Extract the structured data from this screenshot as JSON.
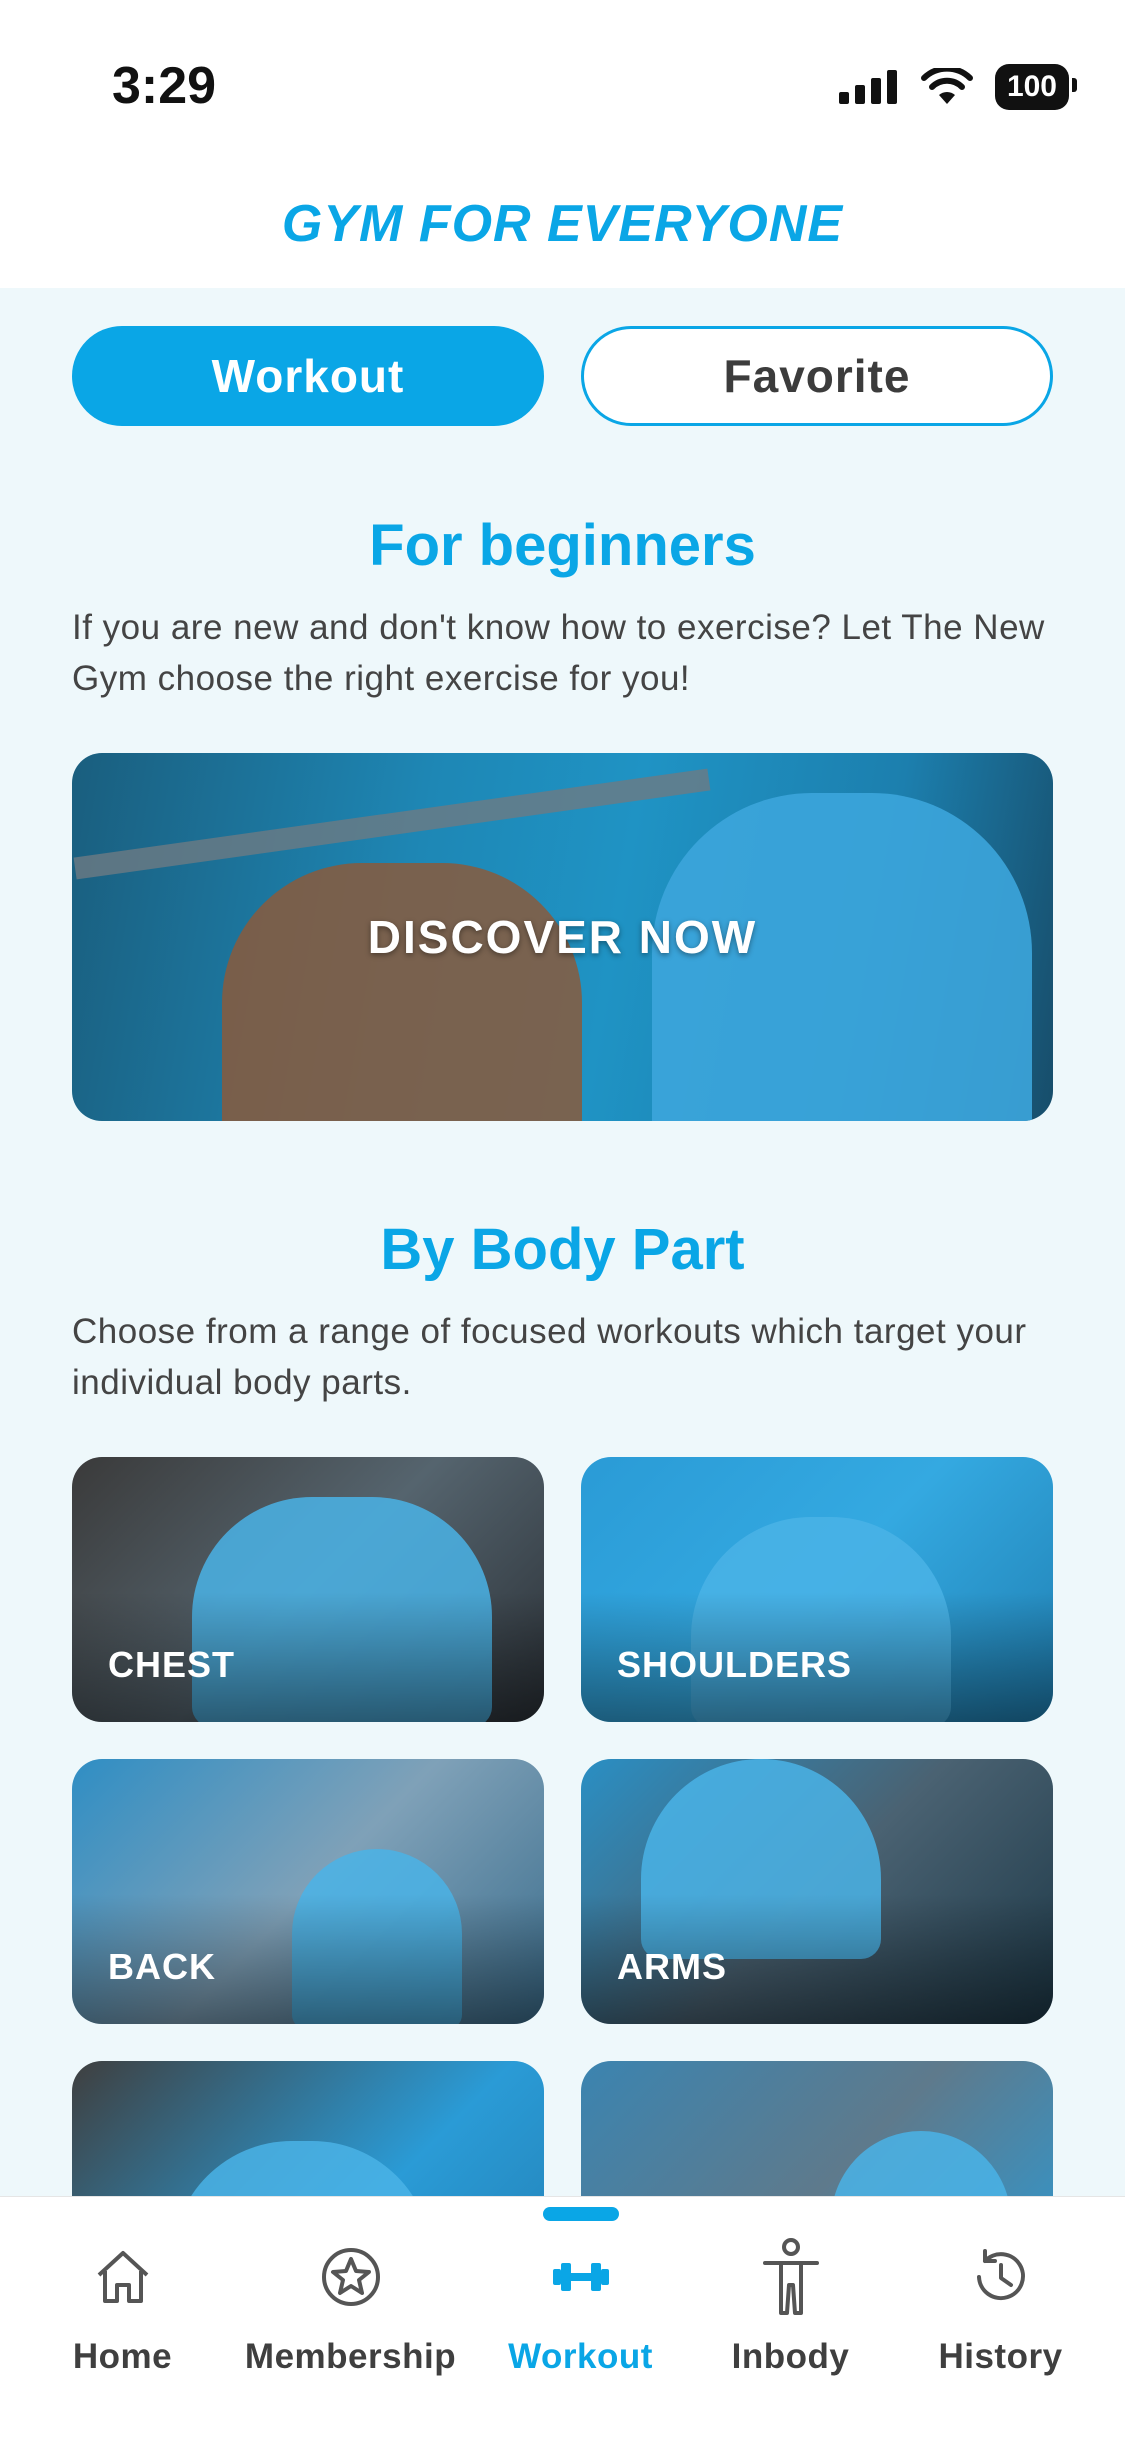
{
  "status": {
    "time": "3:29",
    "battery": "100"
  },
  "header": {
    "title": "GYM FOR EVERYONE"
  },
  "tabs": [
    {
      "label": "Workout"
    },
    {
      "label": "Favorite"
    }
  ],
  "beginners": {
    "title": "For beginners",
    "desc": "If you are new and don't know how to exercise? Let The New Gym choose the right exercise for you!",
    "cta": "DISCOVER NOW"
  },
  "bodypart": {
    "title": "By Body Part",
    "desc": "Choose from a range of focused workouts which target your individual body parts.",
    "cards": [
      {
        "label": "CHEST"
      },
      {
        "label": "SHOULDERS"
      },
      {
        "label": "BACK"
      },
      {
        "label": "ARMS"
      },
      {
        "label": ""
      },
      {
        "label": ""
      }
    ]
  },
  "nav": [
    {
      "label": "Home",
      "icon": "home-icon"
    },
    {
      "label": "Membership",
      "icon": "star-badge-icon"
    },
    {
      "label": "Workout",
      "icon": "dumbbell-icon"
    },
    {
      "label": "Inbody",
      "icon": "body-icon"
    },
    {
      "label": "History",
      "icon": "history-icon"
    }
  ],
  "colors": {
    "accent": "#0aa6e6",
    "background": "#eef8fb",
    "text": "#444444"
  }
}
